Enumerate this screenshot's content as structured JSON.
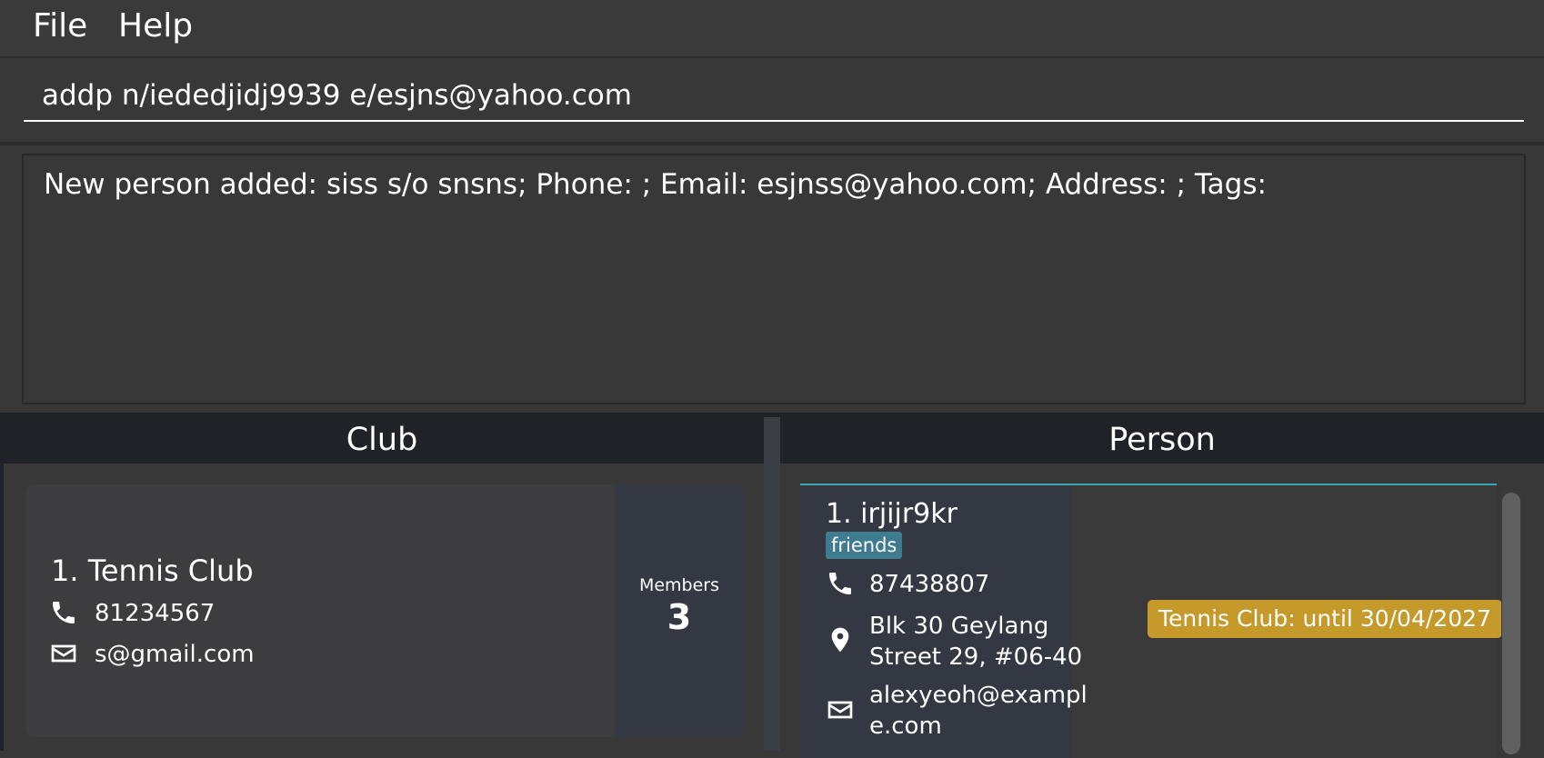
{
  "menu": {
    "file": "File",
    "help": "Help"
  },
  "command": {
    "value": "addp n/iededjidj9939 e/esjns@yahoo.com"
  },
  "result": {
    "message": "New person added: siss s/o snsns; Phone: ; Email: esjnss@yahoo.com; Address: ; Tags:"
  },
  "headers": {
    "club": "Club",
    "person": "Person"
  },
  "club": {
    "name": "1. Tennis Club",
    "phone": "81234567",
    "email": "s@gmail.com",
    "members_label": "Members",
    "members_count": "3"
  },
  "person": {
    "name": "1. irjijr9kr",
    "tag": "friends",
    "phone": "87438807",
    "address_line1": "Blk 30 Geylang",
    "address_line2": "Street 29, #06-40",
    "email_line1": "alexyeoh@exampl",
    "email_line2": "e.com",
    "club_membership": "Tennis Club: until 30/04/2027"
  },
  "colors": {
    "background": "#383838",
    "header": "#1f2328",
    "tag": "#3e7b91",
    "badge": "#c5992a",
    "accent": "#3aa6b0"
  },
  "icons": {
    "phone": "phone-icon",
    "email": "envelope-icon",
    "address": "location-pin-icon"
  }
}
